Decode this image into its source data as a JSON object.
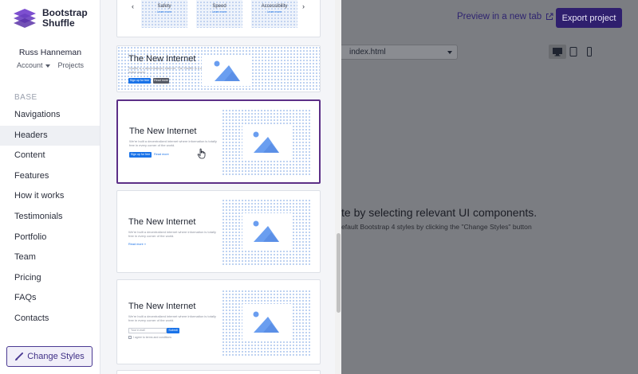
{
  "brand": {
    "line1": "Bootstrap",
    "line2": "Shuffle",
    "logo_color": "#6f42c1"
  },
  "user": {
    "name": "Russ Hanneman",
    "account_label": "Account",
    "projects_label": "Projects"
  },
  "sidebar": {
    "section_label": "BASE",
    "items": [
      {
        "label": "Navigations"
      },
      {
        "label": "Headers"
      },
      {
        "label": "Content"
      },
      {
        "label": "Features"
      },
      {
        "label": "How it works"
      },
      {
        "label": "Testimonials"
      },
      {
        "label": "Portfolio"
      },
      {
        "label": "Team"
      },
      {
        "label": "Pricing"
      },
      {
        "label": "FAQs"
      },
      {
        "label": "Contacts"
      }
    ],
    "active_item": "Headers",
    "change_styles_label": "Change Styles"
  },
  "components": {
    "top_card": {
      "tiles": [
        {
          "label": "Safety",
          "link": "Learn more"
        },
        {
          "label": "Speed",
          "link": "Learn more"
        },
        {
          "label": "Accessibility",
          "link": "Learn more"
        }
      ],
      "prev_arrow": "‹",
      "next_arrow": "›"
    },
    "card1": {
      "title": "The New Internet",
      "text": "Shuffle is a decentralized internet. The Shuffle is a web to democratize an entire world.",
      "primary_button": "Sign up for free",
      "secondary_button": "Read more"
    },
    "card2": {
      "title": "The New Internet",
      "text": "We're built a decentralized internet where information is totally free in every corner of the world.",
      "primary_button": "Sign up for free",
      "secondary_link": "Read more"
    },
    "card3": {
      "title": "The New Internet",
      "text": "We're built a decentralized internet where information is totally free in every corner of the world.",
      "link": "Read more »"
    },
    "card4": {
      "title": "The New Internet",
      "text": "We're built a decentralized internet where information is totally free in every corner of the world.",
      "email_placeholder": "Your e-mail",
      "submit_label": "Submit",
      "agree_text": "I agree to terms and conditions"
    }
  },
  "topbar": {
    "preview_label": "Preview in a new tab",
    "export_label": "Export project"
  },
  "canvas": {
    "file_name": "index.html",
    "empty_heading": "te by selecting relevant UI components.",
    "empty_sub": "efault Bootstrap 4 styles by clicking the \"Change Styles\" button"
  },
  "colors": {
    "accent": "#5c2f87",
    "primary_blue": "#1a73e8",
    "image_icon": "#6a9ef0",
    "overlay": "#7b7d82"
  }
}
